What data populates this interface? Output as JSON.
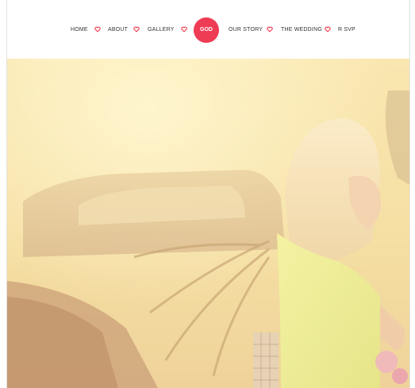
{
  "nav": {
    "items": [
      {
        "label": "HOME"
      },
      {
        "label": "ABOUT"
      },
      {
        "label": "GALLERY"
      },
      {
        "label": "OUR STORY"
      },
      {
        "label": "THE WEDDING"
      },
      {
        "label": "R SVP"
      }
    ],
    "logo_text": "GOD",
    "separator_icon": "heart-icon"
  },
  "colors": {
    "accent": "#ee3c54",
    "nav_text": "#333333",
    "hero_tint": "#f6e1a2"
  },
  "hero": {
    "image_description_icon": "photo-icon"
  }
}
